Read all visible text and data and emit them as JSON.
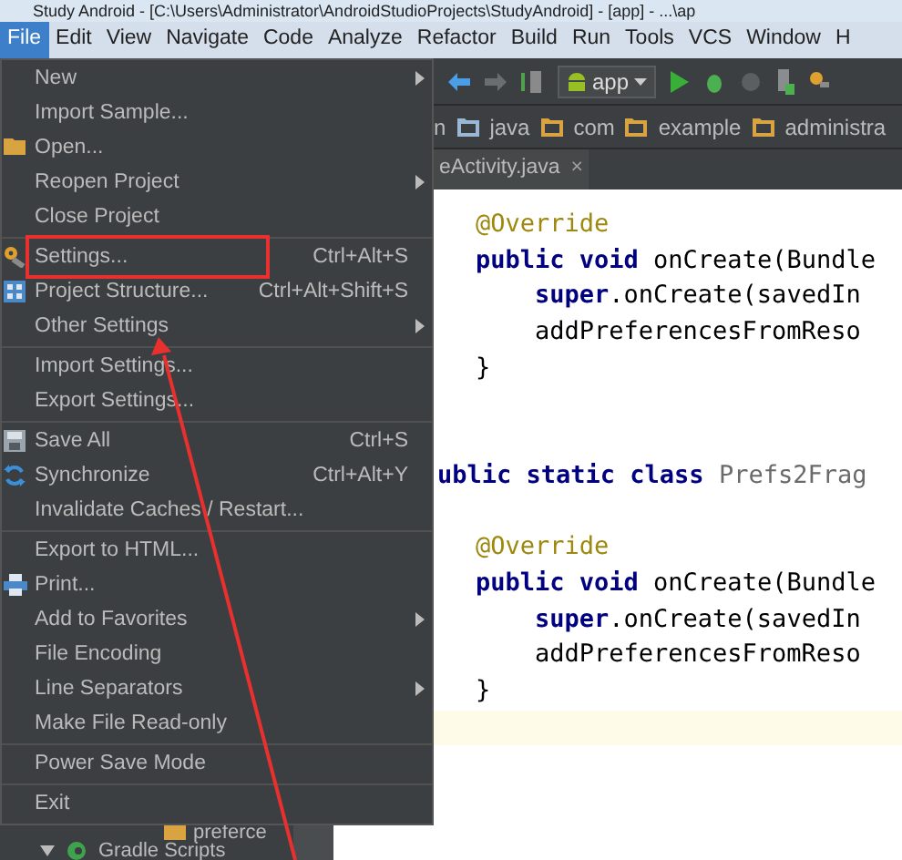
{
  "window": {
    "title": "Study Android - [C:\\Users\\Administrator\\AndroidStudioProjects\\StudyAndroid] - [app] - ...\\ap"
  },
  "menubar": [
    {
      "label": "File",
      "selected": true
    },
    {
      "label": "Edit",
      "selected": false
    },
    {
      "label": "View",
      "selected": false
    },
    {
      "label": "Navigate",
      "selected": false
    },
    {
      "label": "Code",
      "selected": false
    },
    {
      "label": "Analyze",
      "selected": false
    },
    {
      "label": "Refactor",
      "selected": false
    },
    {
      "label": "Build",
      "selected": false
    },
    {
      "label": "Run",
      "selected": false
    },
    {
      "label": "Tools",
      "selected": false
    },
    {
      "label": "VCS",
      "selected": false
    },
    {
      "label": "Window",
      "selected": false
    },
    {
      "label": "H",
      "selected": false
    }
  ],
  "toolbar": {
    "run_config": "app"
  },
  "breadcrumb": [
    "n",
    "java",
    "com",
    "example",
    "administra"
  ],
  "tab": {
    "label": "eActivity.java",
    "close": "×"
  },
  "project_tree": [
    {
      "label": "preferce"
    },
    {
      "label": "Gradle Scripts",
      "expanded": true
    }
  ],
  "code_lines": [
    {
      "kind": "member",
      "segments": [
        {
          "text": "@Override",
          "kind": "annotation"
        }
      ]
    },
    {
      "kind": "member",
      "segments": [
        {
          "text": "public void ",
          "kind": "keyword"
        },
        {
          "text": "onCreate(Bundle",
          "kind": "plain"
        }
      ]
    },
    {
      "kind": "member",
      "segments": [
        {
          "text": "    super",
          "kind": "keyword"
        },
        {
          "text": ".onCreate(savedIn",
          "kind": "plain"
        }
      ]
    },
    {
      "kind": "member",
      "segments": [
        {
          "text": "    addPreferencesFromReso",
          "kind": "plain"
        }
      ]
    },
    {
      "kind": "member",
      "segments": [
        {
          "text": "}",
          "kind": "plain"
        }
      ]
    },
    {
      "kind": "blank"
    },
    {
      "kind": "blank"
    },
    {
      "kind": "declaration",
      "segments": [
        {
          "text": "ublic static class ",
          "kind": "keyword"
        },
        {
          "text": "Prefs2Frag",
          "kind": "class"
        }
      ]
    },
    {
      "kind": "blank"
    },
    {
      "kind": "member",
      "segments": [
        {
          "text": "@Override",
          "kind": "annotation"
        }
      ]
    },
    {
      "kind": "member",
      "segments": [
        {
          "text": "public void ",
          "kind": "keyword"
        },
        {
          "text": "onCreate(Bundle",
          "kind": "plain"
        }
      ]
    },
    {
      "kind": "member",
      "segments": [
        {
          "text": "    super",
          "kind": "keyword"
        },
        {
          "text": ".onCreate(savedIn",
          "kind": "plain"
        }
      ]
    },
    {
      "kind": "member",
      "segments": [
        {
          "text": "    addPreferencesFromReso",
          "kind": "plain"
        }
      ]
    },
    {
      "kind": "member",
      "segments": [
        {
          "text": "}",
          "kind": "plain"
        }
      ]
    }
  ],
  "file_menu": [
    [
      {
        "label": "New",
        "submenu": true
      },
      {
        "label": "Import Sample...",
        "submenu": false
      },
      {
        "label": "Open...",
        "submenu": false
      },
      {
        "label": "Reopen Project",
        "submenu": true
      },
      {
        "label": "Close Project",
        "submenu": false
      }
    ],
    [
      {
        "label": "Settings...",
        "shortcut": "Ctrl+Alt+S",
        "submenu": false,
        "highlighted": true
      },
      {
        "label": "Project Structure...",
        "shortcut": "Ctrl+Alt+Shift+S",
        "submenu": false
      },
      {
        "label": "Other Settings",
        "submenu": true
      }
    ],
    [
      {
        "label": "Import Settings...",
        "submenu": false
      },
      {
        "label": "Export Settings...",
        "submenu": false
      }
    ],
    [
      {
        "label": "Save All",
        "shortcut": "Ctrl+S",
        "submenu": false
      },
      {
        "label": "Synchronize",
        "shortcut": "Ctrl+Alt+Y",
        "submenu": false
      },
      {
        "label": "Invalidate Caches / Restart...",
        "submenu": false
      }
    ],
    [
      {
        "label": "Export to HTML...",
        "submenu": false
      },
      {
        "label": "Print...",
        "submenu": false
      },
      {
        "label": "Add to Favorites",
        "submenu": true
      },
      {
        "label": "File Encoding",
        "submenu": false
      },
      {
        "label": "Line Separators",
        "submenu": true
      },
      {
        "label": "Make File Read-only",
        "submenu": false
      }
    ],
    [
      {
        "label": "Power Save Mode",
        "submenu": false
      }
    ],
    [
      {
        "label": "Exit",
        "submenu": false
      }
    ]
  ]
}
